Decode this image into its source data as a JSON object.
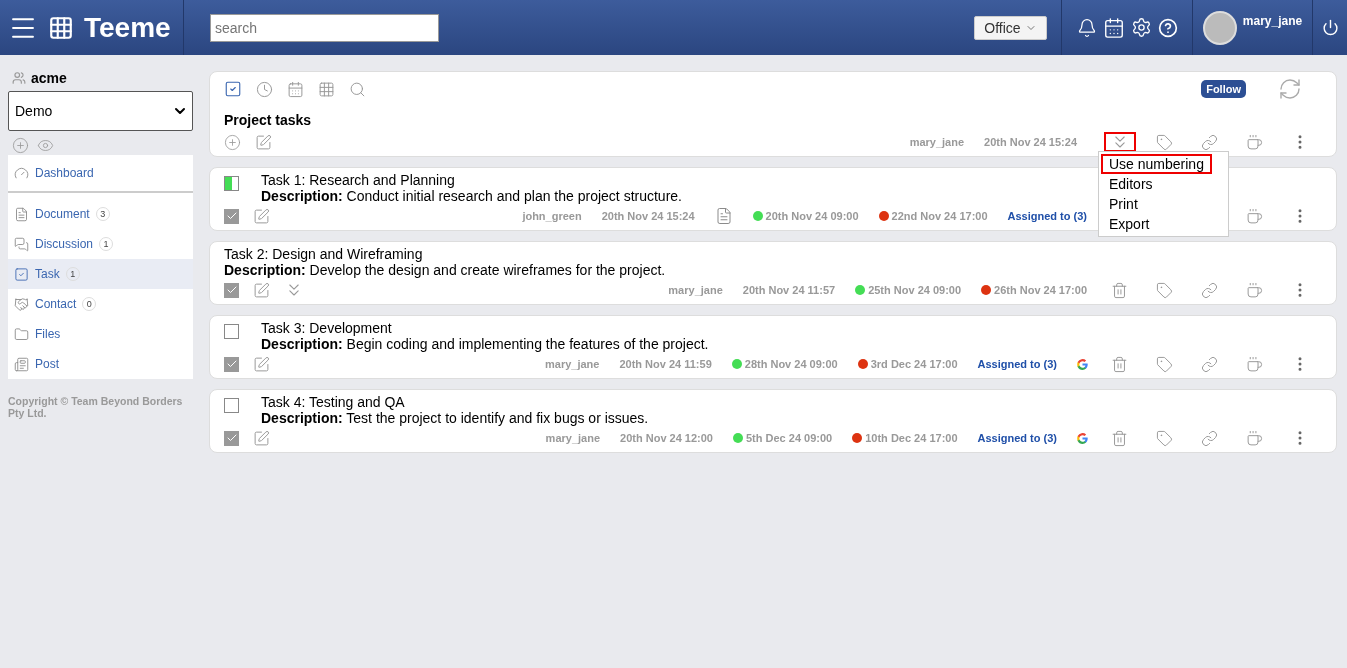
{
  "header": {
    "logo": "Teeme",
    "search": {
      "placeholder": "search"
    },
    "office": "Office",
    "user": "mary_jane"
  },
  "sidebar": {
    "org": "acme",
    "space": "Demo",
    "items": [
      {
        "kind": "dashboard",
        "label": "Dashboard",
        "selected": false
      },
      {
        "kind": "document",
        "label": "Document",
        "count": "3",
        "selected": false
      },
      {
        "kind": "discussion",
        "label": "Discussion",
        "count": "1",
        "selected": false
      },
      {
        "kind": "task",
        "label": "Task",
        "count": "1",
        "selected": true
      },
      {
        "kind": "contact",
        "label": "Contact",
        "count": "0",
        "selected": false
      },
      {
        "kind": "files",
        "label": "Files",
        "selected": false
      },
      {
        "kind": "post",
        "label": "Post",
        "selected": false
      }
    ],
    "copyright": "Copyright © Team Beyond Borders Pty Ltd."
  },
  "project": {
    "title": "Project tasks",
    "follow": "Follow",
    "author": "mary_jane",
    "date": "20th Nov 24 15:24",
    "expand_highlighted": true,
    "menu": [
      {
        "label": "Use numbering",
        "highlighted": true
      },
      {
        "label": "Editors",
        "highlighted": false
      },
      {
        "label": "Print",
        "highlighted": false
      },
      {
        "label": "Export",
        "highlighted": false
      }
    ]
  },
  "tasks": [
    {
      "kind": "progress",
      "level": 0.5,
      "title": "Task 1: Research and Planning",
      "description": "**Description:** Conduct initial research and plan the project structure.",
      "done": true,
      "author": "john_green",
      "created": "20th Nov 24 15:24",
      "doc_icon": true,
      "expand_icon": false,
      "start": {
        "text": "20th Nov 24 09:00",
        "color": "#44dd55"
      },
      "end": {
        "text": "22nd Nov 24 17:00",
        "color": "#dd3311"
      },
      "assigned": "Assigned to (3)",
      "google": false,
      "actions_hidden": true
    },
    {
      "kind": "none",
      "title": "Task 2: Design and Wireframing",
      "description": "**Description:** Develop the design and create wireframes for the project.",
      "done": true,
      "author": "mary_jane",
      "created": "20th Nov 24 11:57",
      "doc_icon": false,
      "expand_icon": true,
      "start": {
        "text": "25th Nov 24 09:00",
        "color": "#44dd55"
      },
      "end": {
        "text": "26th Nov 24 17:00",
        "color": "#dd3311"
      },
      "google": false,
      "actions_hidden": false
    },
    {
      "kind": "checkbox",
      "checked": false,
      "title": "Task 3: Development",
      "description": "**Description:** Begin coding and implementing the features of the project.",
      "done": true,
      "author": "mary_jane",
      "created": "20th Nov 24 11:59",
      "doc_icon": false,
      "expand_icon": false,
      "start": {
        "text": "28th Nov 24 09:00",
        "color": "#44dd55"
      },
      "end": {
        "text": "3rd Dec 24 17:00",
        "color": "#dd3311"
      },
      "assigned": "Assigned to (3)",
      "google": true,
      "actions_hidden": false
    },
    {
      "kind": "checkbox",
      "checked": false,
      "title": "Task 4: Testing and QA",
      "description": "**Description:** Test the project to identify and fix bugs or issues.",
      "done": true,
      "author": "mary_jane",
      "created": "20th Nov 24 12:00",
      "doc_icon": false,
      "expand_icon": false,
      "start": {
        "text": "5th Dec 24 09:00",
        "color": "#44dd55"
      },
      "end": {
        "text": "10th Dec 24 17:00",
        "color": "#dd3311"
      },
      "assigned": "Assigned to (3)",
      "google": true,
      "actions_hidden": false
    }
  ]
}
